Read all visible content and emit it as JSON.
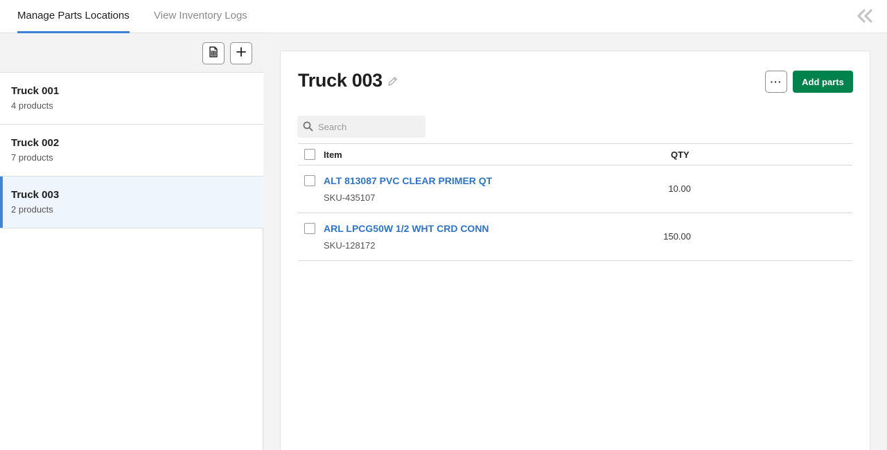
{
  "tabs": {
    "manage": "Manage Parts Locations",
    "logs": "View Inventory Logs"
  },
  "sidebar": {
    "locations": [
      {
        "name": "Truck 001",
        "count": "4 products"
      },
      {
        "name": "Truck 002",
        "count": "7 products"
      },
      {
        "name": "Truck 003",
        "count": "2 products"
      }
    ],
    "selected_index": 2
  },
  "main": {
    "title": "Truck 003",
    "more_label": "···",
    "add_parts_label": "Add parts",
    "search_placeholder": "Search",
    "table": {
      "col_item": "Item",
      "col_qty": "QTY",
      "rows": [
        {
          "name": "ALT 813087 PVC CLEAR PRIMER QT",
          "sku": "SKU-435107",
          "qty": "10.00"
        },
        {
          "name": "ARL LPCG50W 1/2 WHT CRD CONN",
          "sku": "SKU-128172",
          "qty": "150.00"
        }
      ]
    }
  },
  "colors": {
    "accent": "#3d83d8",
    "primary_button": "#00824d",
    "link": "#2e73c4"
  }
}
